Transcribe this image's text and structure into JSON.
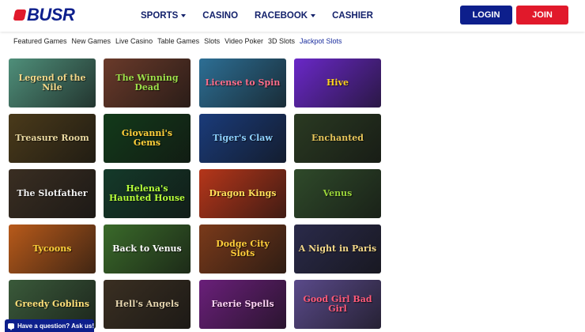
{
  "header": {
    "logo_text": "BUSR",
    "nav": [
      {
        "label": "SPORTS",
        "dropdown": true
      },
      {
        "label": "CASINO",
        "dropdown": false
      },
      {
        "label": "RACEBOOK",
        "dropdown": true
      },
      {
        "label": "CASHIER",
        "dropdown": false
      }
    ],
    "login_label": "LOGIN",
    "join_label": "JOIN"
  },
  "subnav": {
    "items": [
      "Featured Games",
      "New Games",
      "Live Casino",
      "Table Games",
      "Slots",
      "Video Poker",
      "3D Slots",
      "Jackpot Slots"
    ],
    "active_index": 7
  },
  "games": [
    {
      "title": "Legend of the Nile",
      "bg": "#4f8f7a",
      "fg": "#f3d889"
    },
    {
      "title": "The Winning Dead",
      "bg": "#6a3a2a",
      "fg": "#9ee04a"
    },
    {
      "title": "License to Spin",
      "bg": "#2d6f95",
      "fg": "#ff6d8a"
    },
    {
      "title": "Hive",
      "bg": "#6a28c8",
      "fg": "#ffd21f"
    },
    {
      "title": "Treasure Room",
      "bg": "#4a3a1a",
      "fg": "#e9d8a0"
    },
    {
      "title": "Giovanni's Gems",
      "bg": "#123a1a",
      "fg": "#ffcf3a"
    },
    {
      "title": "Tiger's Claw",
      "bg": "#1a3b7a",
      "fg": "#8fd2ff"
    },
    {
      "title": "Enchanted",
      "bg": "#2a3a22",
      "fg": "#e6c55a"
    },
    {
      "title": "The Slotfather",
      "bg": "#3a2e22",
      "fg": "#f2f2f2"
    },
    {
      "title": "Helena's Haunted House",
      "bg": "#143a2a",
      "fg": "#b6ff3a"
    },
    {
      "title": "Dragon Kings",
      "bg": "#b6361a",
      "fg": "#ffe05a"
    },
    {
      "title": "Venus",
      "bg": "#2f4a2a",
      "fg": "#9ad43a"
    },
    {
      "title": "Tycoons",
      "bg": "#b85a1a",
      "fg": "#ffd23a"
    },
    {
      "title": "Back to Venus",
      "bg": "#3a6a2a",
      "fg": "#ffffff"
    },
    {
      "title": "Dodge City Slots",
      "bg": "#7a3a1a",
      "fg": "#ffce3a"
    },
    {
      "title": "A Night in Paris",
      "bg": "#2a2a4a",
      "fg": "#f3d889"
    },
    {
      "title": "Greedy Goblins",
      "bg": "#3a5a3a",
      "fg": "#ffe07a"
    },
    {
      "title": "Hell's Angels",
      "bg": "#3a2f22",
      "fg": "#e6d6b0"
    },
    {
      "title": "Faerie Spells",
      "bg": "#6a1f7a",
      "fg": "#ffd5f5"
    },
    {
      "title": "Good Girl Bad Girl",
      "bg": "#5a4a8a",
      "fg": "#ff5a7a"
    }
  ],
  "chat": {
    "label": "Have a question? Ask us!"
  }
}
